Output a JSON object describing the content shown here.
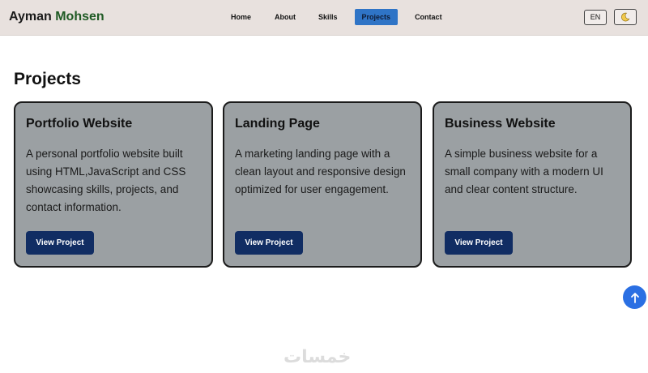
{
  "brand": {
    "first": "Ayman",
    "last": "Mohsen"
  },
  "nav": {
    "items": [
      {
        "label": "Home"
      },
      {
        "label": "About"
      },
      {
        "label": "Skills"
      },
      {
        "label": "Projects",
        "active": true
      },
      {
        "label": "Contact"
      }
    ],
    "active_color": "#2f74c6"
  },
  "controls": {
    "language": "EN",
    "theme_icon": "moon-icon"
  },
  "projects": {
    "title": "Projects",
    "cards": [
      {
        "title": "Portfolio Website",
        "description": "A personal portfolio website built using HTML,JavaScript and CSS showcasing skills, projects, and contact information.",
        "button": "View Project"
      },
      {
        "title": "Landing Page",
        "description": "A marketing landing page with a clean layout and responsive design optimized for user engagement.",
        "button": "View Project"
      },
      {
        "title": "Business Website",
        "description": "A simple business website for a small company with a modern UI and clear content structure.",
        "button": "View Project"
      }
    ]
  },
  "scroll_top": {
    "icon": "arrow-up-icon"
  },
  "watermark": "خمسات"
}
